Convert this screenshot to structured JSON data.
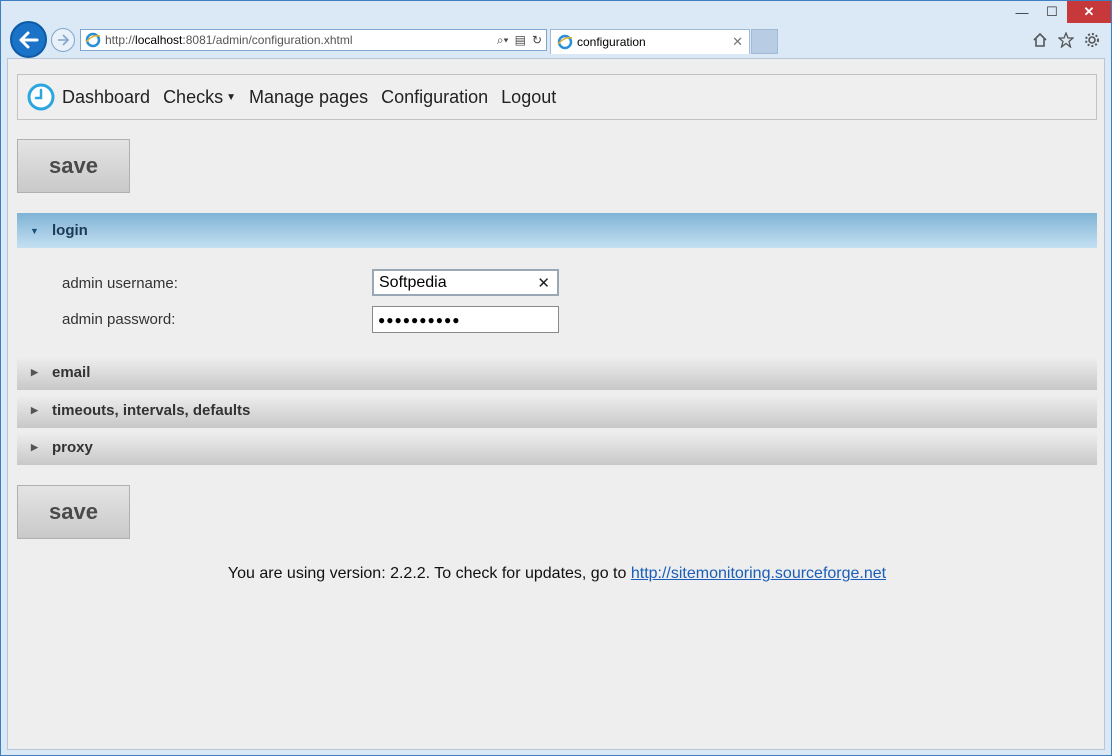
{
  "browser": {
    "url_prefix": "http://",
    "url_host": "localhost",
    "url_rest": ":8081/admin/configuration.xhtml",
    "tab_title": "configuration",
    "window_controls": {
      "minimize": "—",
      "maximize": "☐",
      "close": "✕"
    }
  },
  "nav": {
    "items": [
      {
        "label": "Dashboard"
      },
      {
        "label": "Checks"
      },
      {
        "label": "Manage pages"
      },
      {
        "label": "Configuration"
      },
      {
        "label": "Logout"
      }
    ]
  },
  "actions": {
    "save_label": "save"
  },
  "panels": [
    {
      "title": "login",
      "expanded": true
    },
    {
      "title": "email",
      "expanded": false
    },
    {
      "title": "timeouts, intervals, defaults",
      "expanded": false
    },
    {
      "title": "proxy",
      "expanded": false
    }
  ],
  "login_form": {
    "username_label": "admin username:",
    "username_value": "Softpedia",
    "password_label": "admin password:",
    "password_mask": "●●●●●●●●●●"
  },
  "footer": {
    "text": "You are using version: 2.2.2. To check for updates, go to ",
    "link": "http://sitemonitoring.sourceforge.net"
  },
  "colors": {
    "accent": "#2aa6e0",
    "active_panel": "#7fb3d5",
    "link": "#1b5db8"
  }
}
